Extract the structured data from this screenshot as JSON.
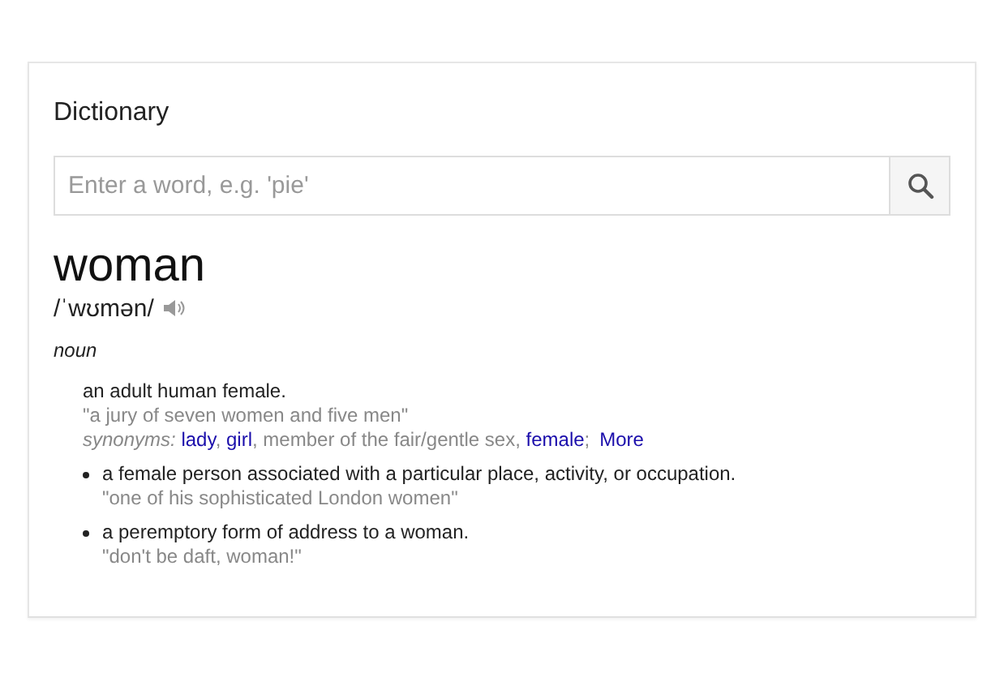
{
  "card": {
    "title": "Dictionary"
  },
  "search": {
    "placeholder": "Enter a word, e.g. 'pie'"
  },
  "entry": {
    "word": "woman",
    "pronunciation": "/ˈwʊmən/",
    "part_of_speech": "noun",
    "senses": [
      {
        "kind": "main",
        "definition": "an adult human female.",
        "example": "\"a jury of seven women and five men\"",
        "synonyms": {
          "label": "synonyms:",
          "segments": [
            {
              "text": "lady",
              "link": true
            },
            {
              "text": ", ",
              "link": false
            },
            {
              "text": "girl",
              "link": true
            },
            {
              "text": ", member of the fair/gentle sex, ",
              "link": false
            },
            {
              "text": "female",
              "link": true
            },
            {
              "text": ";",
              "link": false
            }
          ],
          "more": "More"
        }
      },
      {
        "kind": "bullet",
        "definition": "a female person associated with a particular place, activity, or occupation.",
        "example": "\"one of his sophisticated London women\""
      },
      {
        "kind": "bullet",
        "definition": "a peremptory form of address to a woman.",
        "example": "\"don't be daft, woman!\""
      }
    ]
  }
}
